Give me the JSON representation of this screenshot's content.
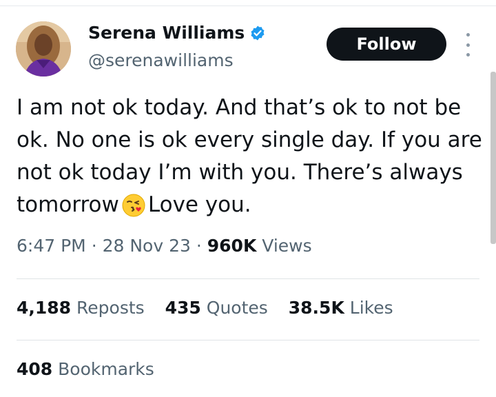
{
  "author": {
    "name": "Serena Williams",
    "handle": "@serenawilliams",
    "verified": true
  },
  "follow_label": "Follow",
  "tweet": {
    "text_before_emoji": "I am not ok today. And that’s ok to not be ok. No one is ok every single day. If you are not ok today I’m with you. There’s always tomorrow",
    "emoji": "face-blowing-a-kiss",
    "text_after_emoji": "Love you."
  },
  "meta": {
    "time": "6:47 PM",
    "separator": "·",
    "date": "28 Nov 23",
    "views_count": "960K",
    "views_label": "Views"
  },
  "stats": {
    "reposts_count": "4,188",
    "reposts_label": "Reposts",
    "quotes_count": "435",
    "quotes_label": "Quotes",
    "likes_count": "38.5K",
    "likes_label": "Likes",
    "bookmarks_count": "408",
    "bookmarks_label": "Bookmarks"
  },
  "colors": {
    "text": "#0f1419",
    "secondary": "#536471",
    "verified": "#1d9bf0",
    "follow_bg": "#0f1419"
  }
}
